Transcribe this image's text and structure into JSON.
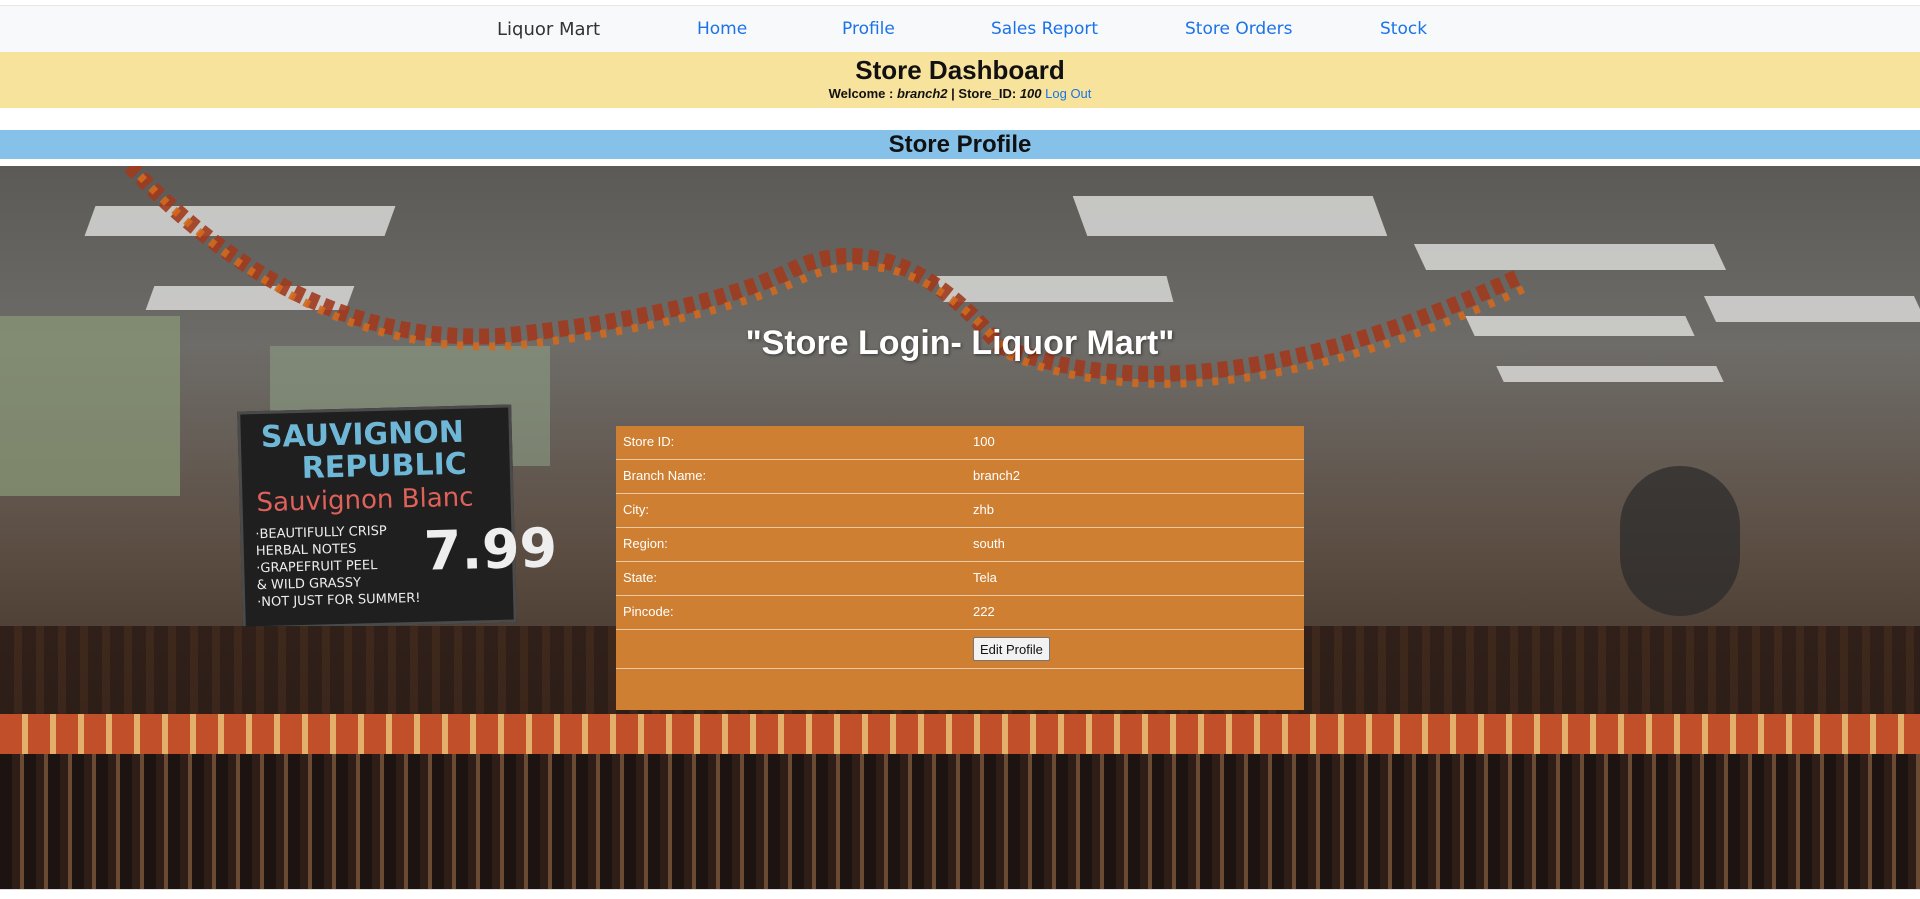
{
  "nav": {
    "brand": "Liquor Mart",
    "links": [
      "Home",
      "Profile",
      "Sales Report",
      "Store Orders",
      "Stock"
    ]
  },
  "header": {
    "title": "Store Dashboard",
    "welcome_label": "Welcome : ",
    "username": "branch2",
    "store_id_label": " | Store_ID: ",
    "store_id": "100",
    "logout": "Log Out"
  },
  "profile_banner": "Store Profile",
  "overlay_title": "\"Store Login- Liquor Mart\"",
  "profile": {
    "rows": [
      {
        "label": "Store ID:",
        "value": "100"
      },
      {
        "label": "Branch Name:",
        "value": "branch2"
      },
      {
        "label": "City:",
        "value": "zhb"
      },
      {
        "label": "Region:",
        "value": "south"
      },
      {
        "label": "State:",
        "value": "Tela"
      },
      {
        "label": "Pincode:",
        "value": "222"
      }
    ],
    "edit_button": "Edit Profile"
  },
  "colors": {
    "header_bg": "#f8e39c",
    "banner_bg": "#85c1e9",
    "table_bg": "#cf7f31",
    "link": "#1a73e8"
  }
}
